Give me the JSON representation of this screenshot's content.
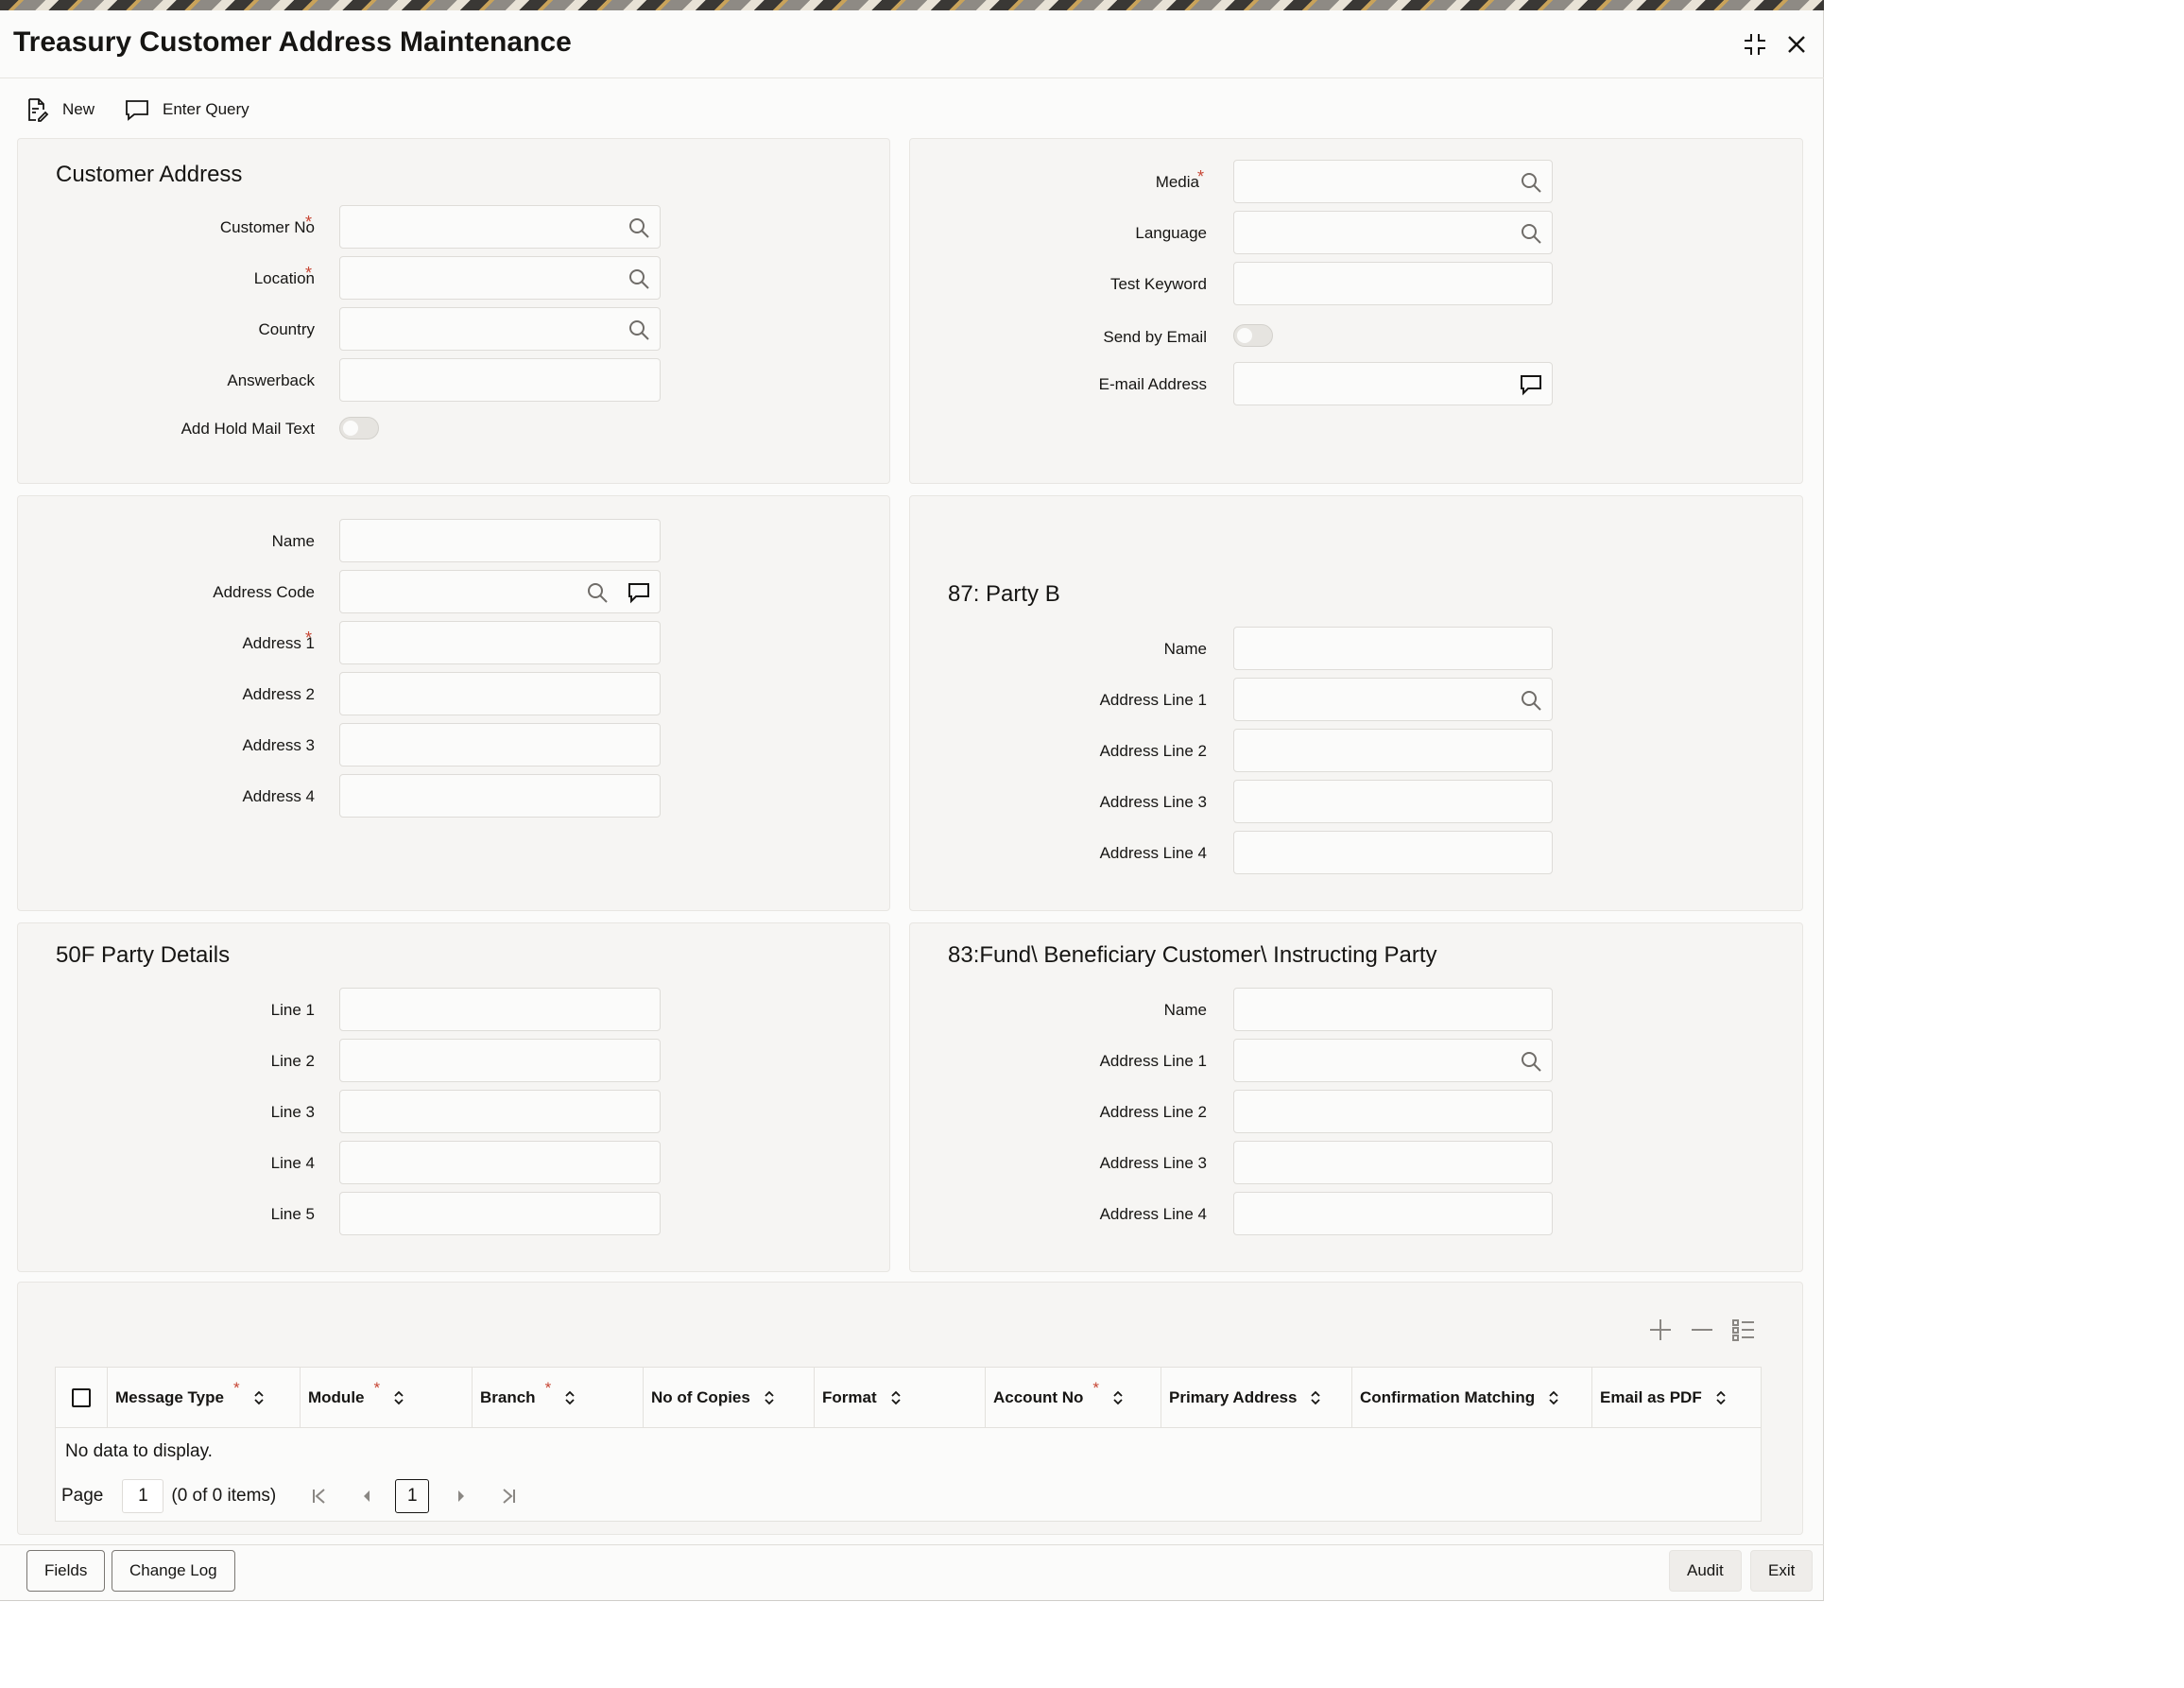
{
  "window": {
    "title": "Treasury Customer Address Maintenance"
  },
  "toolbar": {
    "new_label": "New",
    "enter_query_label": "Enter Query"
  },
  "customer_address": {
    "title": "Customer Address",
    "customer_no": "Customer No",
    "location": "Location",
    "country": "Country",
    "answerback": "Answerback",
    "add_hold_mail_text": "Add Hold Mail Text"
  },
  "media_panel": {
    "media": "Media",
    "language": "Language",
    "test_keyword": "Test Keyword",
    "send_by_email": "Send by Email",
    "email_address": "E-mail Address"
  },
  "address_panel": {
    "name": "Name",
    "address_code": "Address Code",
    "address1": "Address 1",
    "address2": "Address 2",
    "address3": "Address 3",
    "address4": "Address 4"
  },
  "party_b": {
    "title": "87: Party B",
    "name": "Name",
    "line1": "Address Line 1",
    "line2": "Address Line 2",
    "line3": "Address Line 3",
    "line4": "Address Line 4"
  },
  "party_50f": {
    "title": "50F Party Details",
    "line1": "Line 1",
    "line2": "Line 2",
    "line3": "Line 3",
    "line4": "Line 4",
    "line5": "Line 5"
  },
  "party_83": {
    "title": "83:Fund\\ Beneficiary Customer\\ Instructing Party",
    "name": "Name",
    "line1": "Address Line 1",
    "line2": "Address Line 2",
    "line3": "Address Line 3",
    "line4": "Address Line 4"
  },
  "grid": {
    "columns": [
      "Message Type",
      "Module",
      "Branch",
      "No of Copies",
      "Format",
      "Account No",
      "Primary Address",
      "Confirmation Matching",
      "Email as PDF"
    ],
    "no_data": "No data to display.",
    "page_label": "Page",
    "page_value": "1",
    "items_text": "(0 of 0 items)",
    "current_page": "1"
  },
  "footer": {
    "fields": "Fields",
    "change_log": "Change Log",
    "audit": "Audit",
    "exit": "Exit"
  },
  "colors": {
    "required": "#c74634",
    "panel_bg": "#f6f5f3"
  }
}
